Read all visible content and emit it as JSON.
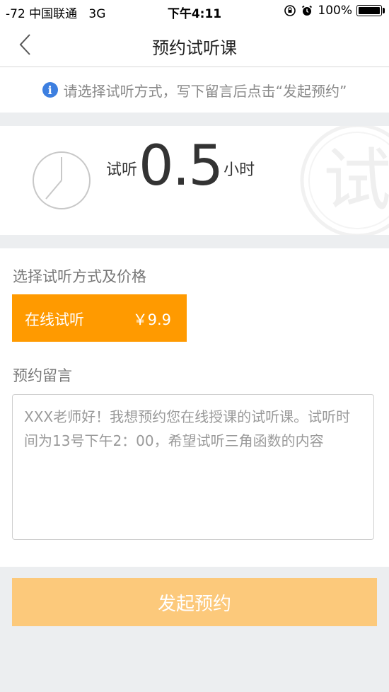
{
  "status_bar": {
    "carrier": "-72 中国联通",
    "network": "3G",
    "time": "下午4:11",
    "battery": "100%",
    "battery_level": 1.0
  },
  "nav": {
    "title": "预约试听课",
    "back_icon": "chevron-left-icon"
  },
  "hint": {
    "icon": "info-icon",
    "text": "请选择试听方式，写下留言后点击“发起预约”"
  },
  "hero": {
    "prefix": "试听",
    "duration": "0.5",
    "unit": "小时",
    "watermark_char": "试",
    "clock_icon": "clock-icon"
  },
  "mode_section": {
    "label": "选择试听方式及价格",
    "options": [
      {
        "name": "在线试听",
        "price": "￥9.9"
      }
    ]
  },
  "message_section": {
    "label": "预约留言",
    "placeholder": "XXX老师好！我想预约您在线授课的试听课。试听时间为13号下午2：00，希望试听三角函数的内容"
  },
  "submit": {
    "label": "发起预约"
  },
  "colors": {
    "accent": "#ff9a00",
    "submit_disabled": "#fcc97b",
    "info_blue": "#3d7fe0",
    "background": "#eceef0"
  }
}
